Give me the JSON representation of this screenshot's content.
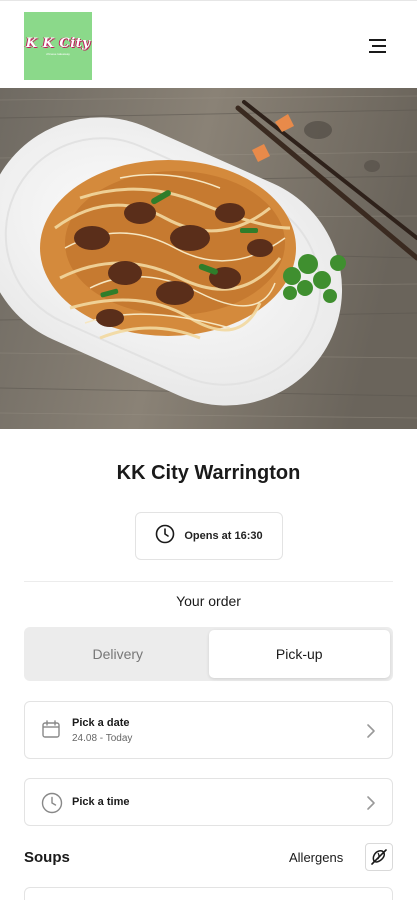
{
  "header": {
    "logo_text": "K K City",
    "logo_subtext": "chinese takeaway",
    "menu_icon": "hamburger-menu-icon"
  },
  "hero": {
    "image": "stir-fried beef noodles on white plate with chopsticks"
  },
  "restaurant": {
    "name": "KK City Warrington",
    "opens_label": "Opens at 16:30",
    "clock_icon": "clock-icon"
  },
  "order": {
    "heading": "Your order",
    "modes": [
      "Delivery",
      "Pick-up"
    ],
    "selected_mode": "Pick-up"
  },
  "pickers": {
    "date_label": "Pick a date",
    "date_value": "24.08 - Today",
    "time_label": "Pick a time"
  },
  "menu_section": {
    "title": "Soups",
    "allergens_label": "Allergens",
    "allergens_icon": "allergens-filter-icon"
  },
  "colors": {
    "logo_bg": "#8bd98a",
    "logo_text_outline": "#c2185b",
    "toggle_bg": "#ececec"
  }
}
